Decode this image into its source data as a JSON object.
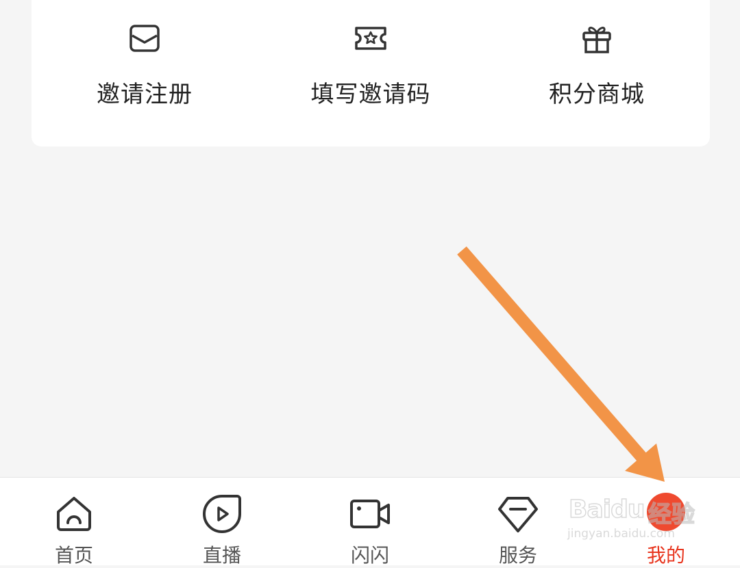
{
  "colors": {
    "accent": "#e8361f",
    "arrow": "#f29447",
    "icon_stroke": "#333333"
  },
  "actions": [
    {
      "label": "邀请注册",
      "icon": "envelope-icon"
    },
    {
      "label": "填写邀请码",
      "icon": "ticket-star-icon"
    },
    {
      "label": "积分商城",
      "icon": "gift-icon"
    }
  ],
  "tabbar": {
    "tabs": [
      {
        "label": "首页",
        "icon": "home-icon"
      },
      {
        "label": "直播",
        "icon": "play-icon"
      },
      {
        "label": "闪闪",
        "icon": "video-camera-icon"
      },
      {
        "label": "服务",
        "icon": "diamond-icon"
      },
      {
        "label": "我的",
        "icon": "profile-icon"
      }
    ],
    "active": "我的"
  },
  "watermark": {
    "brand": "Baidu",
    "product": "经验",
    "url": "jingyan.baidu.com"
  }
}
